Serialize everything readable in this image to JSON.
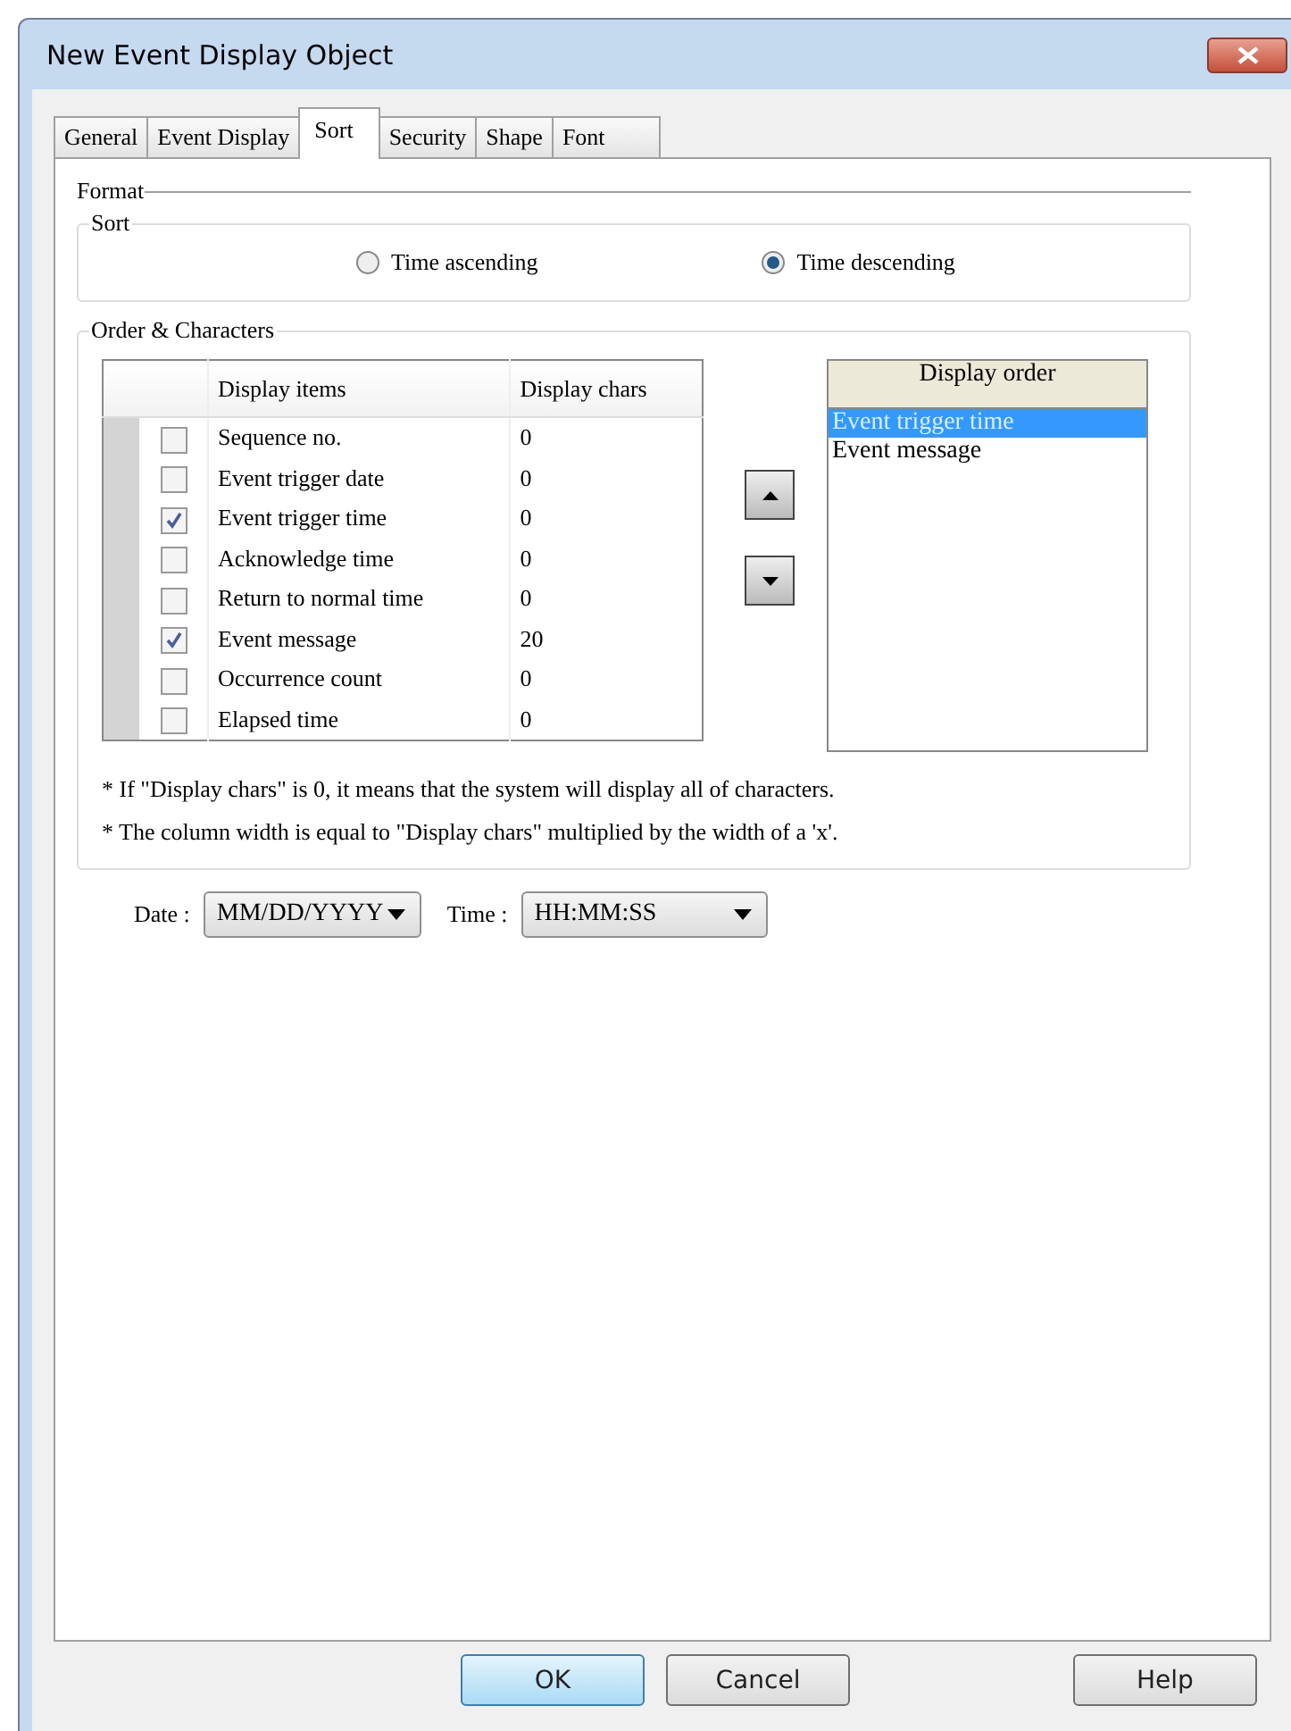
{
  "window": {
    "title": "New Event Display Object"
  },
  "tabs": [
    {
      "label": "General",
      "selected": false
    },
    {
      "label": "Event Display",
      "selected": false
    },
    {
      "label": "Sort",
      "selected": true
    },
    {
      "label": "Security",
      "selected": false
    },
    {
      "label": "Shape",
      "selected": false
    },
    {
      "label": "Font",
      "selected": false
    }
  ],
  "format_label": "Format",
  "sort": {
    "label": "Sort",
    "options": [
      {
        "label": "Time ascending",
        "selected": false
      },
      {
        "label": "Time descending",
        "selected": true
      }
    ]
  },
  "order": {
    "label": "Order & Characters",
    "table": {
      "columns": [
        "Display items",
        "Display chars"
      ],
      "rows": [
        {
          "item": "Sequence no.",
          "chars": "0",
          "checked": false
        },
        {
          "item": "Event trigger date",
          "chars": "0",
          "checked": false
        },
        {
          "item": "Event trigger time",
          "chars": "0",
          "checked": true
        },
        {
          "item": "Acknowledge time",
          "chars": "0",
          "checked": false
        },
        {
          "item": "Return to normal time",
          "chars": "0",
          "checked": false
        },
        {
          "item": "Event message",
          "chars": "20",
          "checked": true
        },
        {
          "item": "Occurrence count",
          "chars": "0",
          "checked": false
        },
        {
          "item": "Elapsed time",
          "chars": "0",
          "checked": false
        }
      ]
    },
    "display_order": {
      "heading": "Display order",
      "items": [
        {
          "label": "Event trigger time",
          "selected": true
        },
        {
          "label": "Event message",
          "selected": false
        }
      ]
    },
    "notes": [
      "* If \"Display chars\" is 0, it means that the system will display all of  characters.",
      "* The column width is equal to \"Display chars\" multiplied by the width of  a 'x'."
    ]
  },
  "date": {
    "label": "Date :",
    "value": "MM/DD/YYYY"
  },
  "time": {
    "label": "Time :",
    "value": "HH:MM:SS"
  },
  "buttons": [
    {
      "label": "OK",
      "default": true
    },
    {
      "label": "Cancel",
      "default": false
    },
    {
      "label": "Help",
      "default": false
    }
  ]
}
